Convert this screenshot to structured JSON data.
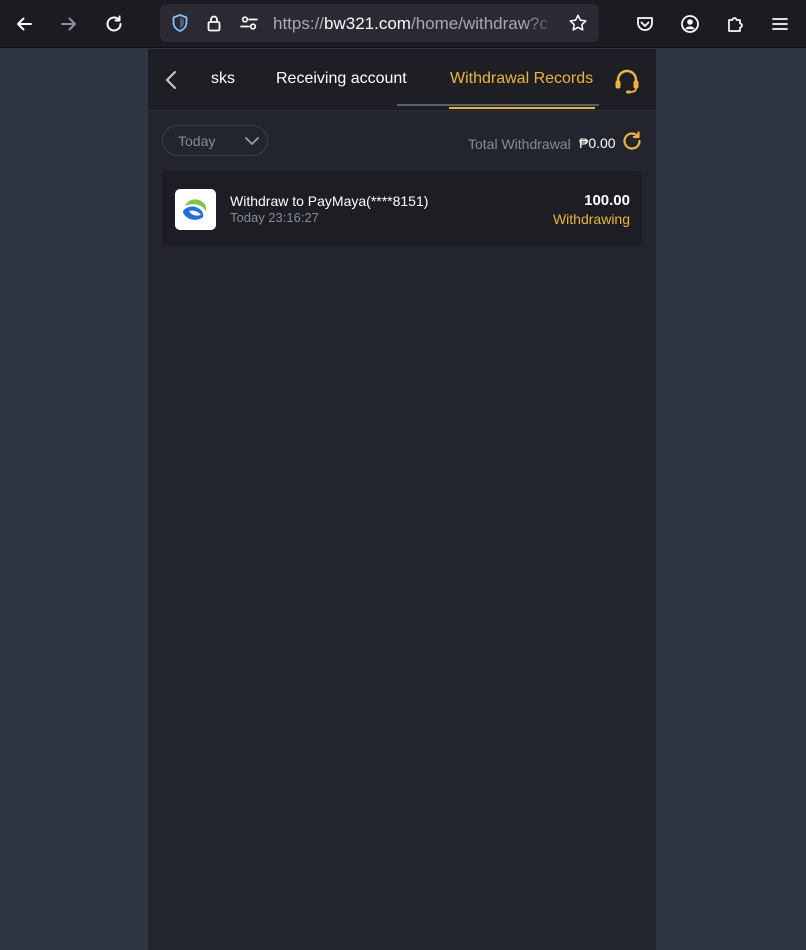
{
  "browser": {
    "url_scheme": "https://",
    "url_domain": "bw321.com",
    "url_path": "/home/withdraw?c",
    "icons": [
      "back-arrow-icon",
      "forward-arrow-icon",
      "reload-icon",
      "shield-icon",
      "lock-icon",
      "permissions-icon",
      "bookmark-star-icon",
      "pocket-icon",
      "account-icon",
      "extensions-icon",
      "menu-icon"
    ]
  },
  "header": {
    "tabs": [
      {
        "label": "sks"
      },
      {
        "label": "Receiving account"
      },
      {
        "label": "Withdrawal Records",
        "active": true
      }
    ],
    "accent_color": "#f0b43c"
  },
  "filter": {
    "date_selected": "Today",
    "total_label": "Total Withdrawal",
    "total_value": "₱0.00"
  },
  "records": [
    {
      "title": "Withdraw to PayMaya(****8151)",
      "time": "Today 23:16:27",
      "amount": "100.00",
      "status": "Withdrawing",
      "icon": "paymaya-logo-icon"
    }
  ],
  "colors": {
    "page_bg": "#2f3642",
    "app_bg": "#22252d",
    "card_bg": "#1c1e24",
    "status_color": "#f0b43c"
  }
}
